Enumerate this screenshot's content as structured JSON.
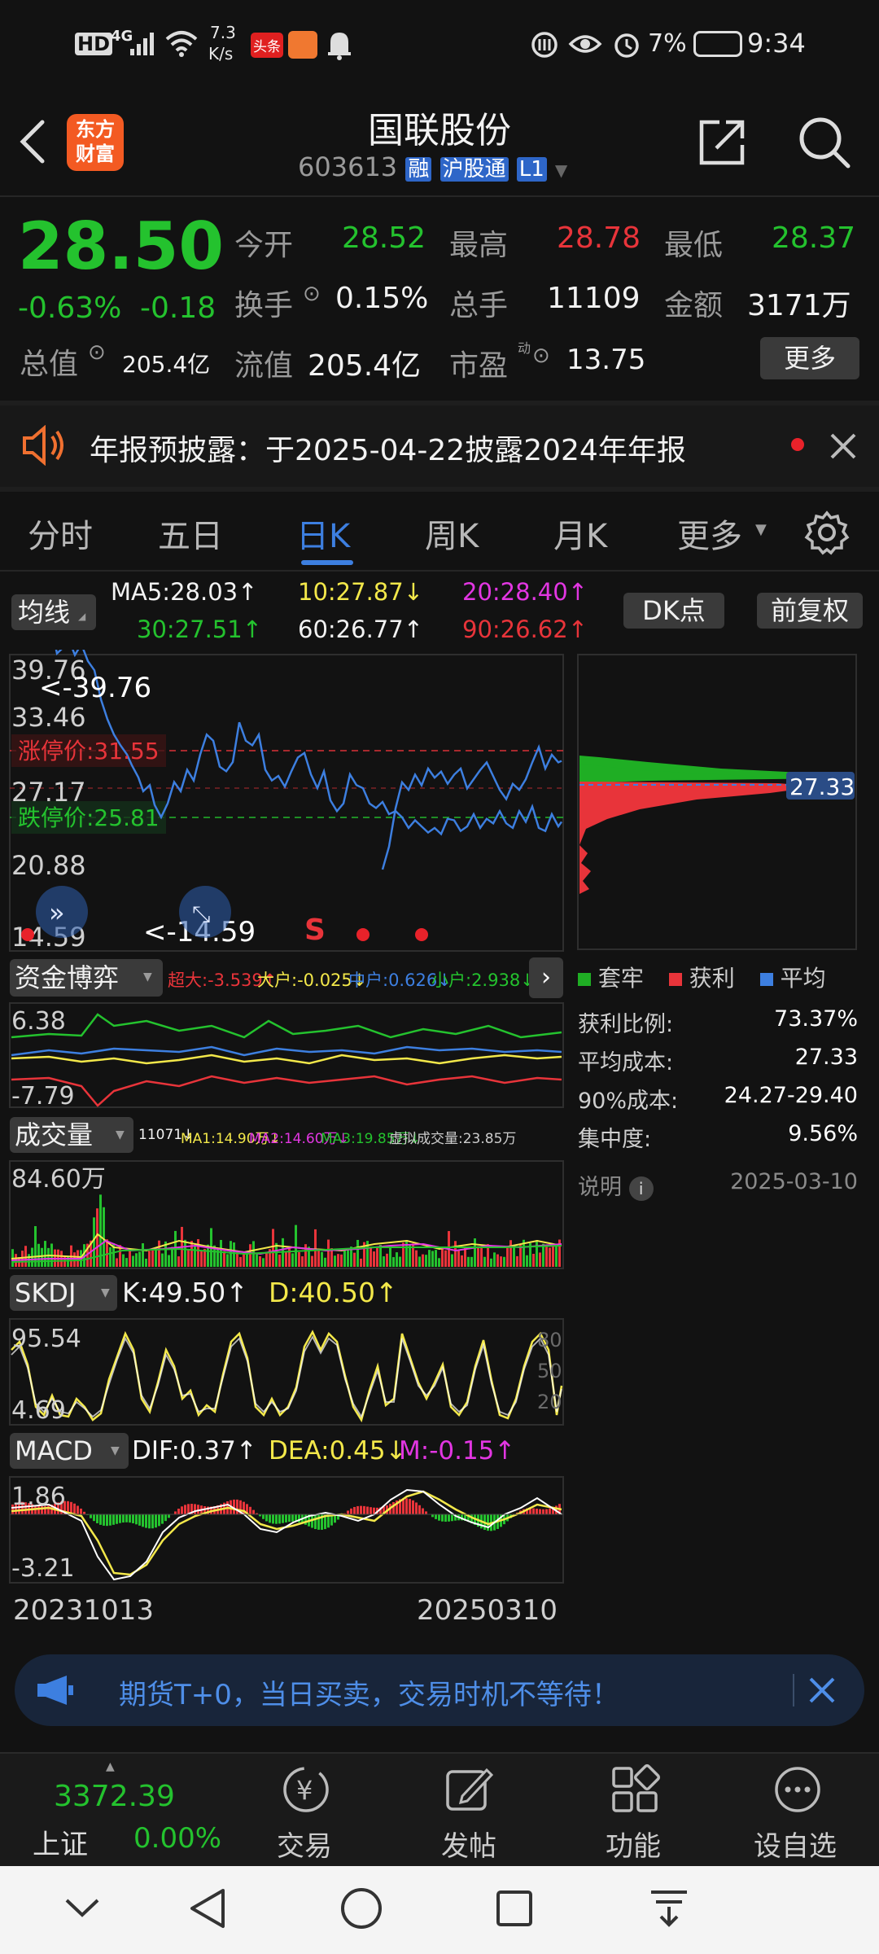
{
  "status_bar": {
    "hd": "HD",
    "net": "4G",
    "speed_top": "7.3",
    "speed_bottom": "K/s",
    "app1": "头条",
    "battery": "7%",
    "time": "9:34"
  },
  "header": {
    "logo_top": "东方",
    "logo_bottom": "财富",
    "title": "国联股份",
    "code": "603613",
    "tags": [
      "融",
      "沪股通",
      "L1"
    ]
  },
  "quote": {
    "price": "28.50",
    "change_pct": "-0.63%",
    "change": "-0.18",
    "open_label": "今开",
    "open": "28.52",
    "high_label": "最高",
    "high": "28.78",
    "low_label": "最低",
    "low": "28.37",
    "turnover_label": "换手",
    "turnover": "0.15%",
    "volume_label": "总手",
    "volume": "11109",
    "amount_label": "金额",
    "amount": "3171万",
    "mcap_label": "总值",
    "mcap": "205.4亿",
    "float_label": "流值",
    "float_cap": "205.4亿",
    "pe_label": "市盈",
    "pe_sup": "动",
    "pe": "13.75",
    "more_btn": "更多"
  },
  "notice": {
    "text": "年报预披露：于2025-04-22披露2024年年报"
  },
  "tabs": [
    "分时",
    "五日",
    "日K",
    "周K",
    "月K",
    "更多"
  ],
  "active_tab": 2,
  "kline": {
    "ma_btn": "均线",
    "ma5": "MA5:28.03↑",
    "ma10": "10:27.87↓",
    "ma20": "20:28.40↑",
    "ma30": "30:27.51↑",
    "ma60": "60:26.77↑",
    "ma90": "90:26.62↑",
    "dk_btn": "DK点",
    "fq_btn": "前复权",
    "y_top": "39.76",
    "y_2": "33.46",
    "y_3": "27.17",
    "y_4": "20.88",
    "y_bottom": "14.59",
    "max_label": "<-39.76",
    "min_label": "<-14.59",
    "limit_up": "涨停价:31.55",
    "limit_down": "跌停价:25.81",
    "signal_s": "S"
  },
  "chip_dist": {
    "avg_tag": "27.33",
    "legend": [
      "套牢",
      "获利",
      "平均"
    ],
    "rows": [
      {
        "label": "获利比例:",
        "value": "73.37%"
      },
      {
        "label": "平均成本:",
        "value": "27.33"
      },
      {
        "label": "90%成本:",
        "value": "24.27-29.40"
      },
      {
        "label": "集中度:",
        "value": "9.56%"
      }
    ],
    "note_label": "说明",
    "note_date": "2025-03-10"
  },
  "fund": {
    "btn": "资金博弈",
    "super": "超大:-3.539↑",
    "big": "大户:-0.025↓",
    "mid": "中户:0.626↓",
    "small": "小户:2.938↓",
    "y_top": "6.38",
    "y_bottom": "-7.79"
  },
  "volume": {
    "btn": "成交量",
    "legend": "11071↓",
    "ma1": "MA1:14.90万↓",
    "ma2": "MA2:14.60万↓",
    "ma3": "MA3:19.85万↓",
    "virtual": "虚拟成交量:23.85万",
    "y_top": "84.60万"
  },
  "skdj": {
    "btn": "SKDJ",
    "k": "K:49.50↑",
    "d": "D:40.50↑",
    "y_top": "95.54",
    "y_bottom": "4.69",
    "r_top": "80",
    "r_mid": "50",
    "r_bot": "20"
  },
  "macd": {
    "btn": "MACD",
    "dif": "DIF:0.37↑",
    "dea": "DEA:0.45↓",
    "m": "M:-0.15↑",
    "y_top": "1.86",
    "y_bottom": "-3.21"
  },
  "dates": {
    "start": "20231013",
    "end": "20250310"
  },
  "ad": {
    "text": "期货T+0，当日买卖，交易时机不等待！"
  },
  "bottom_nav": {
    "index_value": "3372.39",
    "index_name": "上证",
    "index_change": "0.00%",
    "items": [
      "交易",
      "发帖",
      "功能",
      "设自选"
    ]
  },
  "colors": {
    "up": "#e8343a",
    "down": "#24c22e",
    "accent": "#3d7fe0",
    "bg": "#121212"
  }
}
